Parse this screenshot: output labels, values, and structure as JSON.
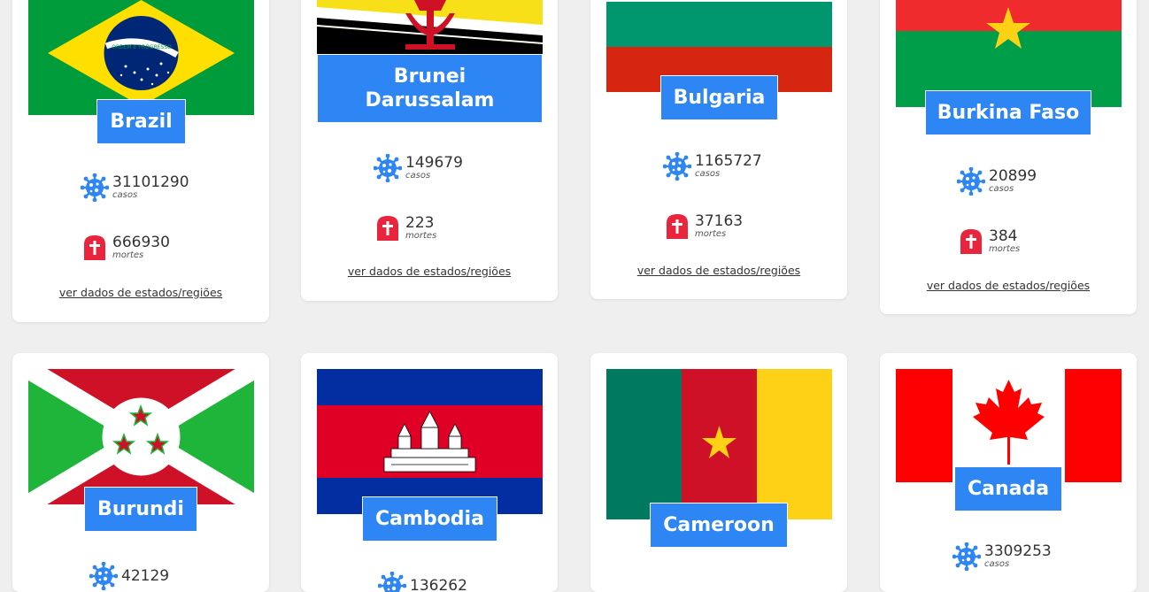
{
  "countries": [
    {
      "name": "Brazil",
      "cases": "31101290",
      "deaths": "666930",
      "cases_label": "casos",
      "deaths_label": "mortes",
      "link": "ver dados de estados/regiões"
    },
    {
      "name": "Brunei Darussalam",
      "cases": "149679",
      "deaths": "223",
      "cases_label": "casos",
      "deaths_label": "mortes",
      "link": "ver dados de estados/regiões"
    },
    {
      "name": "Bulgaria",
      "cases": "1165727",
      "deaths": "37163",
      "cases_label": "casos",
      "deaths_label": "mortes",
      "link": "ver dados de estados/regiões"
    },
    {
      "name": "Burkina Faso",
      "cases": "20899",
      "deaths": "384",
      "cases_label": "casos",
      "deaths_label": "mortes",
      "link": "ver dados de estados/regiões"
    },
    {
      "name": "Burundi",
      "cases": "42129"
    },
    {
      "name": "Cambodia",
      "cases": "136262"
    },
    {
      "name": "Cameroon"
    },
    {
      "name": "Canada",
      "cases": "3309253",
      "cases_label": "casos"
    }
  ],
  "brazil_motto": "ORDEM E PROGRESSO",
  "colors": {
    "accent": "#2e86f5",
    "virus": "#2e86f5",
    "death": "#e8253c"
  }
}
